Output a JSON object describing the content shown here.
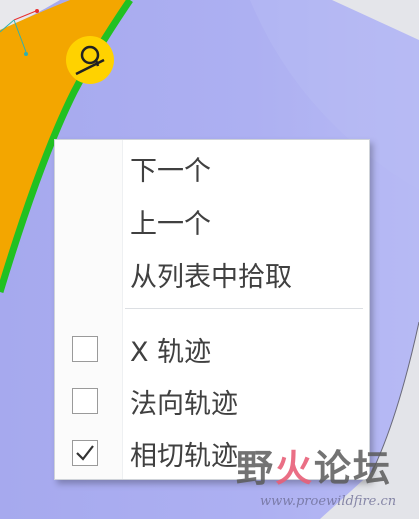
{
  "context_menu": {
    "items": [
      {
        "label": "下一个"
      },
      {
        "label": "上一个"
      },
      {
        "label": "从列表中拾取"
      }
    ],
    "check_items": [
      {
        "label": "X 轨迹",
        "checked": false
      },
      {
        "label": "法向轨迹",
        "checked": false
      },
      {
        "label": "相切轨迹",
        "checked": true
      }
    ]
  },
  "watermark": {
    "part1": "野",
    "part2": "火",
    "part3": "论坛",
    "url": "www.proewildfire.cn"
  },
  "icons": {
    "badge": "curve-entity-badge-icon",
    "cursor": "mouse-pointer-icon"
  },
  "colors": {
    "background": "#a9acf0",
    "surface_orange": "#f0a400",
    "edge_green": "#22c022",
    "badge_yellow": "#ffd200"
  }
}
